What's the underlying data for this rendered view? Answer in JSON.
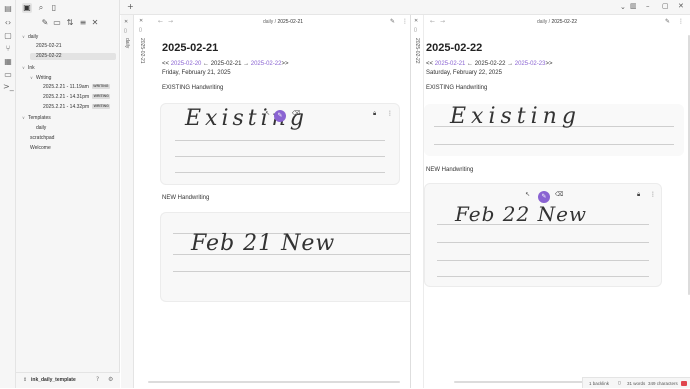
{
  "ribbon": {
    "icons": [
      "sidebar-toggle-icon",
      "code-icon",
      "file-icon",
      "graph-icon",
      "calendar-icon",
      "document-icon",
      "terminal-icon"
    ]
  },
  "sidebar": {
    "toolbar_icons": [
      "new-note-icon",
      "new-folder-icon",
      "sort-icon",
      "collapse-icon",
      "close-icon"
    ],
    "tree": {
      "daily": "daily",
      "daily_items": [
        "2025-02-21",
        "2025-02-22"
      ],
      "ink": "Ink",
      "writing": "Writing",
      "writing_items": [
        {
          "label": "2025.2.21 - 11.19am",
          "badge": "WRITING"
        },
        {
          "label": "2025.2.21 - 14.31pm",
          "badge": "WRITING"
        },
        {
          "label": "2025.2.21 - 14.32pm",
          "badge": "WRITING"
        }
      ],
      "templates": "Templates",
      "templates_items": [
        "daily"
      ],
      "root_items": [
        "scratchpad",
        "Welcome"
      ]
    },
    "vault_name": "ink_daily_template"
  },
  "left_strip": {
    "label1": "daily",
    "label2": "2025-02-21"
  },
  "right_strip": {
    "label1": "2025-02-22"
  },
  "pane_left": {
    "breadcrumb_folder": "daily",
    "breadcrumb_sep": "/",
    "breadcrumb_file": "2025-02-21",
    "title": "2025-02-21",
    "nav_prefix": "<< ",
    "nav_prev": "2025-02-20",
    "nav_mid": " ← 2025-02-21 → ",
    "nav_next": "2025-02-22",
    "nav_suffix": ">>",
    "date_line": "Friday, February 21, 2025",
    "existing_label": "EXISTING Handwriting",
    "existing_ink": "Existing",
    "new_label": "NEW Handwriting",
    "new_ink": "Feb 21 New"
  },
  "pane_right": {
    "breadcrumb_folder": "daily",
    "breadcrumb_sep": "/",
    "breadcrumb_file": "2025-02-22",
    "title": "2025-02-22",
    "nav_prefix": "<< ",
    "nav_prev": "2025-02-21",
    "nav_mid": " ← 2025-02-22 → ",
    "nav_next": "2025-02-23",
    "nav_suffix": ">>",
    "date_line": "Saturday, February 22, 2025",
    "existing_label": "EXISTING Handwriting",
    "existing_ink": "Existing",
    "new_label": "NEW Handwriting",
    "new_ink": "Feb 22 New"
  },
  "status": {
    "backlinks": "1 backlink",
    "words": "31 words",
    "chars": "349 characters"
  },
  "colors": {
    "accent": "#8a63d2",
    "sidebar_bg": "#f6f6f6",
    "error": "#e0464e"
  }
}
